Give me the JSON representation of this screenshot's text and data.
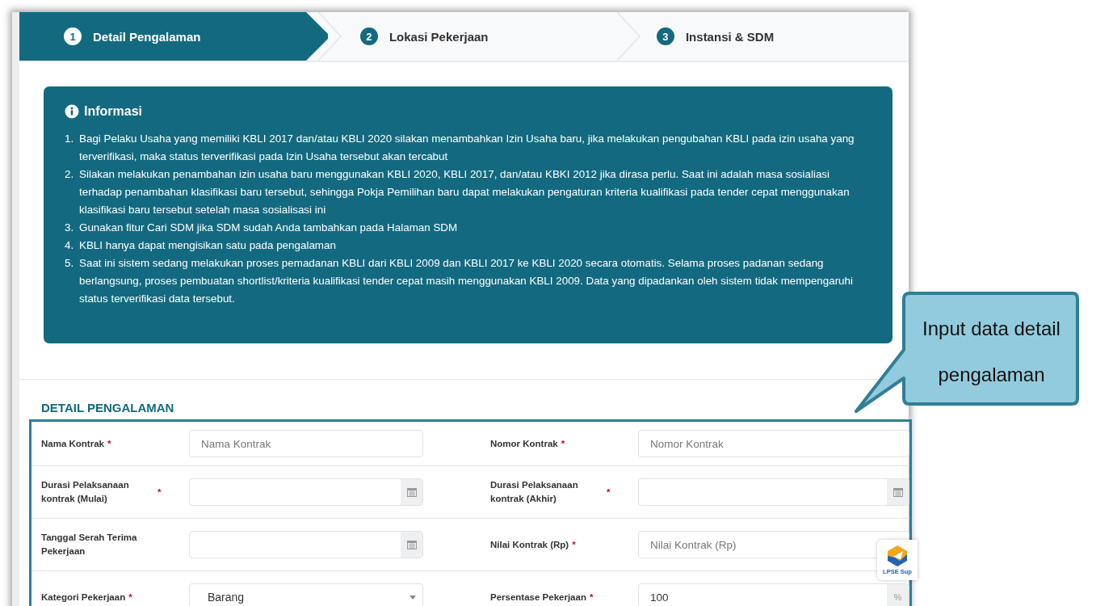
{
  "steps": [
    {
      "number": "1",
      "label": "Detail Pengalaman",
      "selected": true
    },
    {
      "number": "2",
      "label": "Lokasi Pekerjaan",
      "selected": false
    },
    {
      "number": "3",
      "label": "Instansi & SDM",
      "selected": false
    }
  ],
  "info": {
    "title": "Informasi",
    "items": [
      {
        "number": "1.",
        "text": "Bagi Pelaku Usaha yang memiliki KBLI 2017 dan/atau KBLI 2020 silakan menambahkan Izin Usaha baru, jika melakukan pengubahan KBLI pada izin usaha yang terverifikasi, maka status terverifikasi pada Izin Usaha tersebut akan tercabut"
      },
      {
        "number": "2.",
        "text": "Silakan melakukan penambahan izin usaha baru menggunakan KBLI 2020, KBLI 2017, dan/atau KBKI 2012 jika dirasa perlu. Saat ini adalah masa sosialiasi terhadap penambahan klasifikasi baru tersebut, sehingga Pokja Pemilihan baru dapat melakukan pengaturan kriteria kualifikasi pada tender cepat menggunakan klasifikasi baru tersebut setelah masa sosialisasi ini"
      },
      {
        "number": "3.",
        "text": "Gunakan fitur Cari SDM jika SDM sudah Anda tambahkan pada Halaman SDM"
      },
      {
        "number": "4.",
        "text": "KBLI hanya dapat mengisikan satu pada pengalaman"
      },
      {
        "number": "5.",
        "text": "Saat ini sistem sedang melakukan proses pemadanan KBLI dari KBLI 2009 dan KBLI 2017 ke KBLI 2020 secara otomatis. Selama proses padanan sedang berlangsung, proses pembuatan shortlist/kriteria kualifikasi tender cepat masih menggunakan KBLI 2009. Data yang dipadankan oleh sistem tidak mempengaruhi status terverifikasi data tersebut."
      }
    ]
  },
  "section_title": "DETAIL PENGALAMAN",
  "form_rows": [
    [
      {
        "label": "Nama Kontrak",
        "required_mark": "*",
        "kind": "text",
        "placeholder": "Nama Kontrak"
      },
      {
        "label": "Nomor Kontrak",
        "required_mark": "*",
        "kind": "text",
        "placeholder": "Nomor Kontrak"
      }
    ],
    [
      {
        "label": "Durasi Pelaksanaan kontrak (Mulai)",
        "required_mark": "*",
        "kind": "date"
      },
      {
        "label": "Durasi Pelaksanaan kontrak (Akhir)",
        "required_mark": "*",
        "kind": "date"
      }
    ],
    [
      {
        "label": "Tanggal Serah Terima Pekerjaan",
        "kind": "date"
      },
      {
        "label": "Nilai Kontrak (Rp)",
        "required_mark": "*",
        "kind": "text",
        "placeholder": "Nilai Kontrak (Rp)"
      }
    ],
    [
      {
        "label": "Kategori Pekerjaan",
        "required_mark": "*",
        "kind": "select",
        "value": "Barang"
      },
      {
        "label": "Persentase Pekerjaan",
        "required_mark": "*",
        "kind": "addon",
        "value": "100",
        "addon": "%"
      }
    ]
  ],
  "support_widget": {
    "label": "LPSE Sup"
  },
  "callout": {
    "text": "Input data detail pengalaman"
  }
}
